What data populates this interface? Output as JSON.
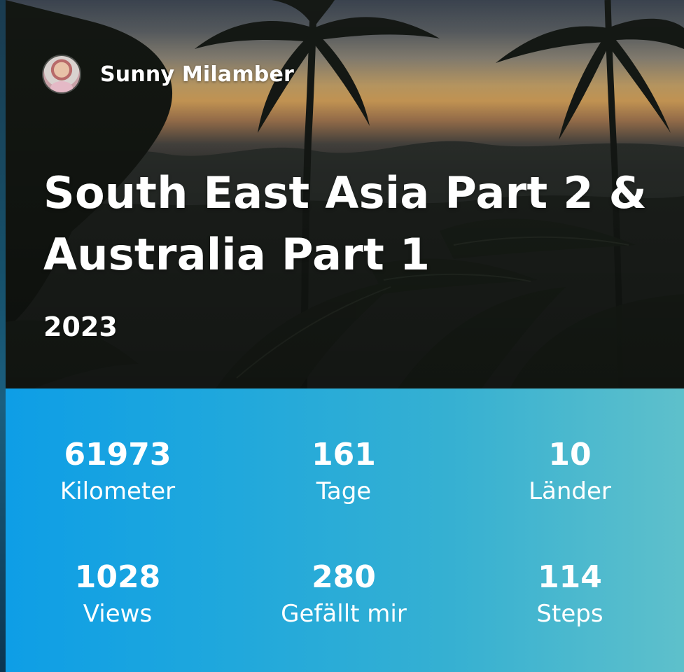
{
  "author": {
    "name": "Sunny Milamber"
  },
  "trip": {
    "title": "South East Asia Part 2 & Australia Part 1",
    "year": "2023"
  },
  "stats": {
    "kilometer": {
      "value": "61973",
      "label": "Kilometer"
    },
    "days": {
      "value": "161",
      "label": "Tage"
    },
    "countries": {
      "value": "10",
      "label": "Länder"
    },
    "views": {
      "value": "1028",
      "label": "Views"
    },
    "likes": {
      "value": "280",
      "label": "Gefällt mir"
    },
    "steps": {
      "value": "114",
      "label": "Steps"
    }
  },
  "colors": {
    "panel_start": "#0e9ee6",
    "panel_end": "#5ec0cb",
    "text": "#ffffff"
  }
}
